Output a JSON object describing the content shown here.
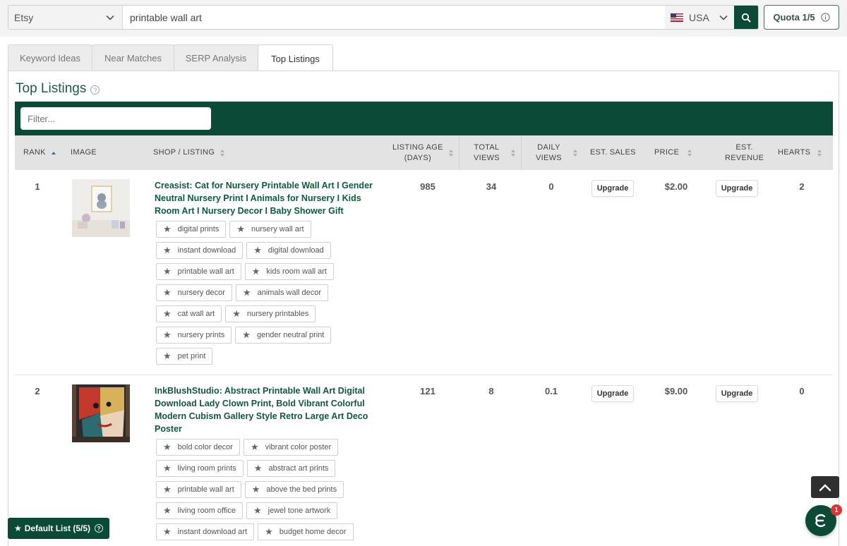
{
  "search": {
    "platform": "Etsy",
    "query": "printable wall art",
    "country": "USA",
    "quota_label": "Quota 1/5"
  },
  "tabs": [
    {
      "label": "Keyword Ideas"
    },
    {
      "label": "Near Matches"
    },
    {
      "label": "SERP Analysis"
    },
    {
      "label": "Top Listings"
    }
  ],
  "active_tab": "Top Listings",
  "panel": {
    "title": "Top Listings",
    "filter_placeholder": "Filter..."
  },
  "columns": {
    "rank": "RANK",
    "image": "IMAGE",
    "shop_listing": "SHOP / LISTING",
    "listing_age_1": "LISTING AGE",
    "listing_age_2": "(DAYS)",
    "total_views_1": "TOTAL",
    "total_views_2": "VIEWS",
    "daily_views_1": "DAILY",
    "daily_views_2": "VIEWS",
    "est_sales": "EST. SALES",
    "price": "PRICE",
    "est_revenue_1": "EST.",
    "est_revenue_2": "REVENUE",
    "hearts": "HEARTS"
  },
  "listings": [
    {
      "rank": "1",
      "shop": "Creasist",
      "title_rest": ": Cat for Nursery Printable Wall Art I Gender Neutral Nursery Print I Animals for Nursery I Kids Room Art I Nursery Decor I Baby Shower Gift",
      "listing_age": "985",
      "total_views": "34",
      "daily_views": "0",
      "est_sales": "Upgrade",
      "price": "$2.00",
      "est_revenue": "Upgrade",
      "hearts": "2",
      "tags": [
        "digital prints",
        "nursery wall art",
        "instant download",
        "digital download",
        "printable wall art",
        "kids room wall art",
        "nursery decor",
        "animals wall decor",
        "cat wall art",
        "nursery printables",
        "nursery prints",
        "gender neutral print",
        "pet print"
      ]
    },
    {
      "rank": "2",
      "shop": "InkBlushStudio",
      "title_rest": ": Abstract Printable Wall Art Digital Download Lady Clown Print, Bold Vibrant Colorful Modern Cubism Gallery Style Retro Large Art Deco Poster",
      "listing_age": "121",
      "total_views": "8",
      "daily_views": "0.1",
      "est_sales": "Upgrade",
      "price": "$9.00",
      "est_revenue": "Upgrade",
      "hearts": "0",
      "tags": [
        "bold color decor",
        "vibrant color poster",
        "living room prints",
        "abstract art prints",
        "printable wall art",
        "above the bed prints",
        "living room office",
        "jewel tone artwork",
        "instant download art",
        "budget home decor"
      ]
    }
  ],
  "default_list_label": "Default List (5/5)",
  "chat_badge": "1",
  "icons": {
    "search": "search-icon",
    "info": "info-icon",
    "star": "star-icon",
    "scroll_top": "chevron-up-icon",
    "chat": "chat-icon"
  },
  "colors": {
    "brand_green": "#0b4a36",
    "title_green": "#0e5a3c",
    "badge_red": "#dd3333"
  }
}
